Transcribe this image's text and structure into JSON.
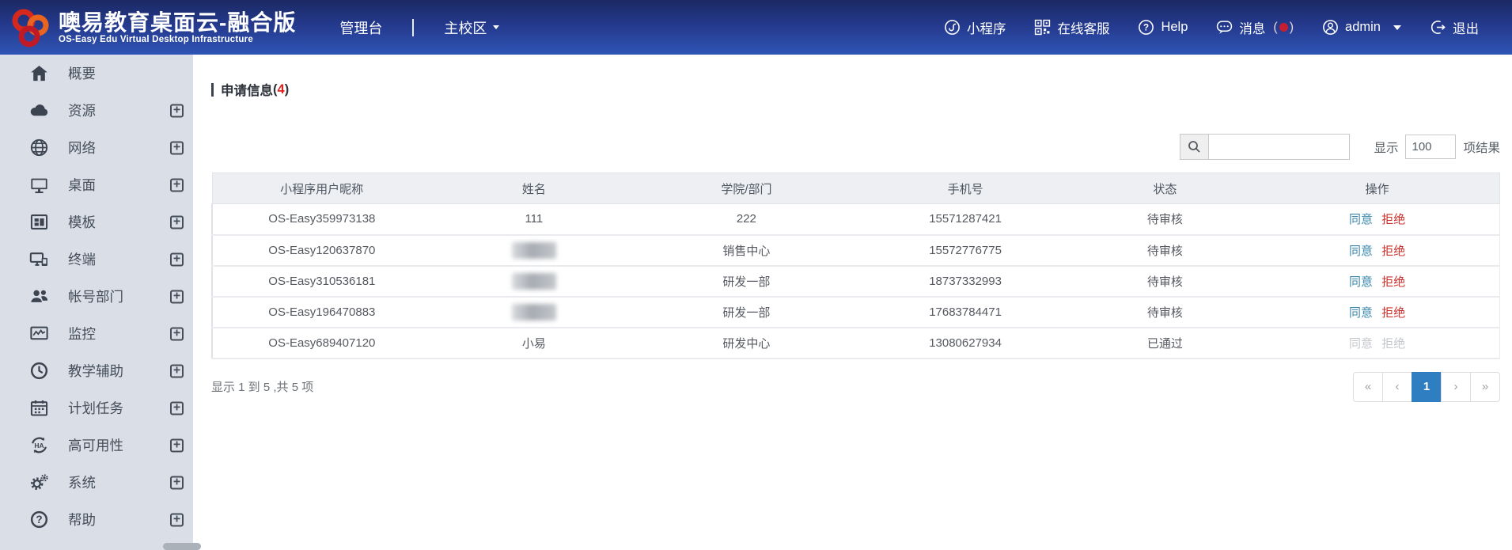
{
  "topbar": {
    "title": "噢易教育桌面云-融合版",
    "subtitle": "OS-Easy Edu Virtual Desktop Infrastructure",
    "nav_console": "管理台",
    "campus": "主校区",
    "mini_program": "小程序",
    "online_service": "在线客服",
    "help": "Help",
    "messages": "消息",
    "username": "admin",
    "logout": "退出"
  },
  "sidebar": {
    "expand_glyph": "+",
    "items": [
      {
        "label": "概要",
        "icon": "home-icon",
        "expandable": false
      },
      {
        "label": "资源",
        "icon": "cloud-icon",
        "expandable": true
      },
      {
        "label": "网络",
        "icon": "globe-icon",
        "expandable": true
      },
      {
        "label": "桌面",
        "icon": "desktop-icon",
        "expandable": true
      },
      {
        "label": "模板",
        "icon": "template-icon",
        "expandable": true
      },
      {
        "label": "终端",
        "icon": "terminal-icon",
        "expandable": true
      },
      {
        "label": "帐号部门",
        "icon": "users-icon",
        "expandable": true
      },
      {
        "label": "监控",
        "icon": "monitor-chart-icon",
        "expandable": true
      },
      {
        "label": "教学辅助",
        "icon": "clock-icon",
        "expandable": true
      },
      {
        "label": "计划任务",
        "icon": "calendar-icon",
        "expandable": true
      },
      {
        "label": "高可用性",
        "icon": "ha-icon",
        "expandable": true
      },
      {
        "label": "系统",
        "icon": "gears-icon",
        "expandable": true
      },
      {
        "label": "帮助",
        "icon": "question-icon",
        "expandable": true
      }
    ]
  },
  "main": {
    "title": "申请信息",
    "paren_open": "(",
    "count": "4",
    "paren_close": ")",
    "show_label": "显示",
    "page_size": "100",
    "results_label": "项结果",
    "table": {
      "headers": [
        "小程序用户昵称",
        "姓名",
        "学院/部门",
        "手机号",
        "状态",
        "操作"
      ],
      "approve_label": "同意",
      "reject_label": "拒绝",
      "rows": [
        {
          "nickname": "OS-Easy359973138",
          "name": "111",
          "name_blurred": false,
          "dept": "222",
          "phone": "15571287421",
          "status": "待审核",
          "actions_enabled": true
        },
        {
          "nickname": "OS-Easy120637870",
          "name": "",
          "name_blurred": true,
          "dept": "销售中心",
          "phone": "15572776775",
          "status": "待审核",
          "actions_enabled": true
        },
        {
          "nickname": "OS-Easy310536181",
          "name": "",
          "name_blurred": true,
          "dept": "研发一部",
          "phone": "18737332993",
          "status": "待审核",
          "actions_enabled": true
        },
        {
          "nickname": "OS-Easy196470883",
          "name": "",
          "name_blurred": true,
          "dept": "研发一部",
          "phone": "17683784471",
          "status": "待审核",
          "actions_enabled": true
        },
        {
          "nickname": "OS-Easy689407120",
          "name": "小易",
          "name_blurred": false,
          "dept": "研发中心",
          "phone": "13080627934",
          "status": "已通过",
          "actions_enabled": false
        }
      ]
    },
    "footer_info": "显示 1 到 5 ,共 5 项",
    "pagination": {
      "first": "«",
      "prev": "‹",
      "page": "1",
      "next": "›",
      "last": "»"
    }
  },
  "colors": {
    "topbar_top": "#1b2963",
    "topbar_bottom": "#2f55b5",
    "sidebar_bg": "#dadfe7",
    "active_page_blue": "#2f7ec1",
    "approve_blue": "#3a87ad",
    "reject_red": "#c9302c",
    "count_red": "#d9231f"
  }
}
